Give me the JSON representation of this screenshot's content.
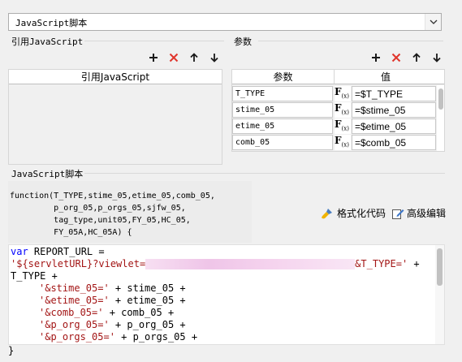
{
  "script_select": {
    "value": "JavaScript脚本"
  },
  "ref_section": {
    "title": "引用JavaScript",
    "column_header": "引用JavaScript"
  },
  "param_section": {
    "title": "参数",
    "columns": [
      "参数",
      "值"
    ],
    "rows": [
      {
        "name": "T_TYPE",
        "fx": "F",
        "value": "=$T_TYPE"
      },
      {
        "name": "stime_05",
        "fx": "F",
        "value": "=$stime_05"
      },
      {
        "name": "etime_05",
        "fx": "F",
        "value": "=$etime_05"
      },
      {
        "name": "comb_05",
        "fx": "F",
        "value": "=$comb_05"
      }
    ]
  },
  "script_section": {
    "title": "JavaScript脚本",
    "signature": [
      "function(T_TYPE,stime_05,etime_05,comb_05,",
      "         p_org_05,p_orgs_05,sjfw_05,",
      "         tag_type,unit05,FY_05,HC_05,",
      "         FY_05A,HC_05A) {"
    ],
    "format_label": "格式化代码",
    "advanced_label": "高级编辑",
    "code": {
      "line1_kw": "var",
      "line1_rest": " REPORT_URL =",
      "line2_start": "'${servletURL}?viewlet=",
      "line2_end": "&T_TYPE='",
      "line2_op": " +",
      "line3": "T_TYPE +",
      "concat": [
        {
          "str": "'&stime_05='",
          "rest": " + stime_05 +"
        },
        {
          "str": "'&etime_05='",
          "rest": " + etime_05 +"
        },
        {
          "str": "'&comb_05='",
          "rest": " + comb_05 +"
        },
        {
          "str": "'&p_org_05='",
          "rest": " + p_org_05 +"
        },
        {
          "str": "'&p_orgs_05='",
          "rest": " + p_orgs_05 +"
        }
      ]
    },
    "closing_brace": "}"
  },
  "colors": {
    "add": "#1a1a1a",
    "delete": "#e0352b",
    "keyword": "#0000ff",
    "string": "#a31515"
  }
}
